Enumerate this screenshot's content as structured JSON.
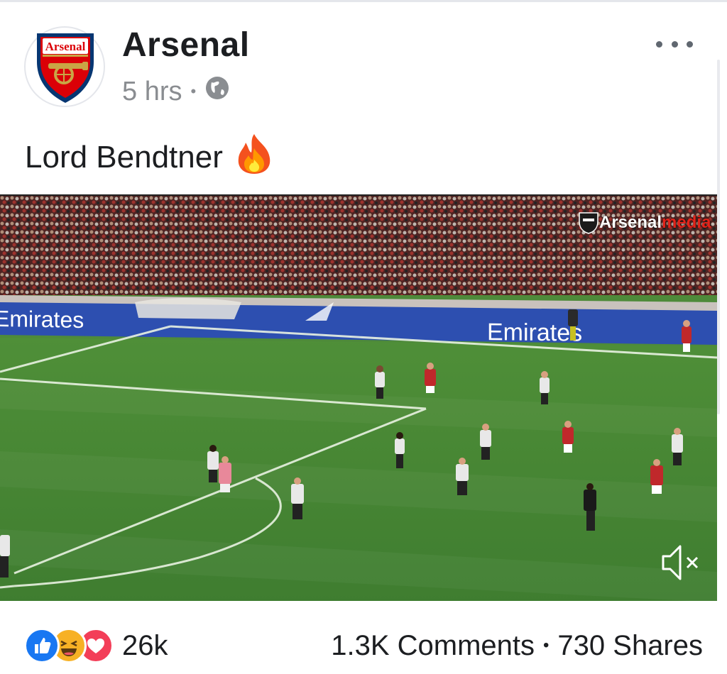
{
  "post": {
    "page_name": "Arsenal",
    "avatar_badge_text": "Arsenal",
    "time": "5 hrs",
    "privacy_icon": "globe-icon",
    "text": "Lord Bendtner",
    "emoji": "fire-emoji"
  },
  "video": {
    "watermark_brand": "Arsenal",
    "watermark_media": "media",
    "sponsor_board_left": "Emirates",
    "sponsor_board_right": "Emirates",
    "sound_state": "muted"
  },
  "footer": {
    "reaction_icons": [
      "like-icon",
      "haha-icon",
      "love-icon"
    ],
    "reaction_count": "26k",
    "comments": "1.3K Comments",
    "separator": "•",
    "shares": "730 Shares"
  },
  "colors": {
    "like": "#1877f2",
    "haha": "#f7b125",
    "love": "#f33e58",
    "arsenal_red": "#db0007",
    "arsenal_blue": "#063672",
    "pitch": "#4e8a3a"
  }
}
